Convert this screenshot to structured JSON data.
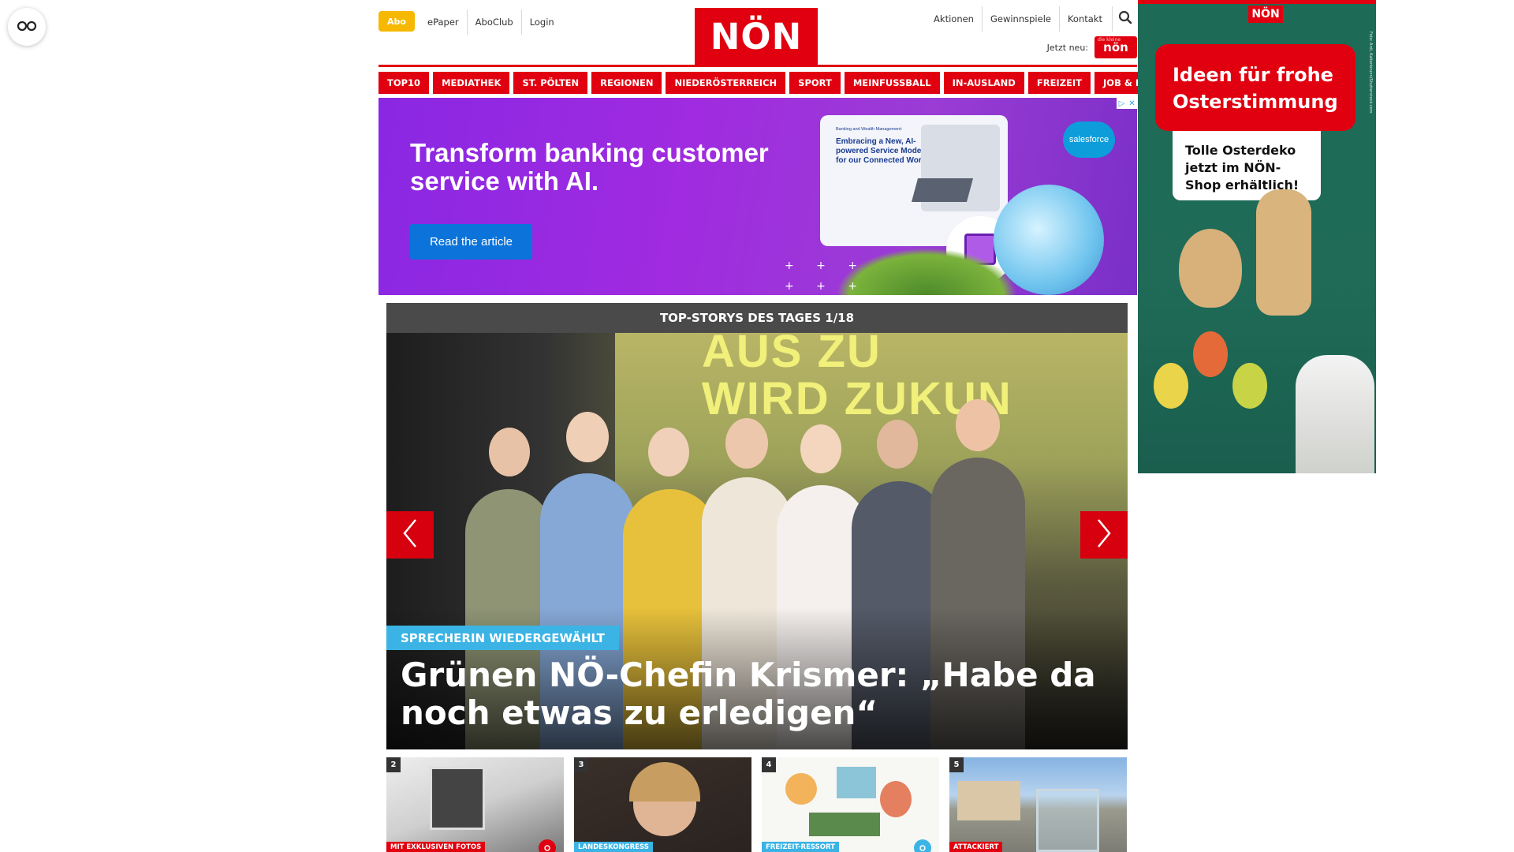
{
  "header": {
    "abo_label": "Abo",
    "left_links": [
      "ePaper",
      "AboClub",
      "Login"
    ],
    "logo_text": "NÖN",
    "right_links": [
      "Aktionen",
      "Gewinnspiele",
      "Kontakt"
    ],
    "jetzt_label": "Jetzt neu:",
    "jetzt_badge": "nön"
  },
  "nav": {
    "items": [
      "TOP10",
      "MEDIATHEK",
      "ST. PÖLTEN",
      "REGIONEN",
      "NIEDERÖSTERREICH",
      "SPORT",
      "MEINFUSSBALL",
      "IN-AUSLAND",
      "FREIZEIT",
      "JOB & KARRIERE"
    ]
  },
  "ad": {
    "headline": "Transform banking customer service with AI.",
    "cta": "Read the article",
    "card_small": "Banking and Wealth Management:",
    "card_text": "Embracing a New, AI-powered Service Model for our Connected World",
    "brand": "salesforce"
  },
  "top_stories": {
    "header": "TOP-STORYS DES TAGES 1/18",
    "screen_text": "AUS ZU\nWIRD ZUKUN",
    "kicker": "SPRECHERIN WIEDERGEWÄHLT",
    "title": "Grünen NÖ-Chefin Krismer: „Habe da noch etwas zu erledigen“"
  },
  "thumbnails": [
    {
      "num": "2",
      "tag": "MIT EXKLUSIVEN FOTOS",
      "tag_color": "#e1000f"
    },
    {
      "num": "3",
      "tag": "LANDESKONGRESS",
      "tag_color": "#3bb4e5"
    },
    {
      "num": "4",
      "tag": "FREIZEIT-RESSORT",
      "tag_color": "#3bb4e5"
    },
    {
      "num": "5",
      "tag": "ATTACKIERT",
      "tag_color": "#e1000f"
    }
  ],
  "side_ad": {
    "logo": "NÖN",
    "headline": "Ideen für frohe Osterstimmung",
    "note": "Tolle Osterdeko jetzt im NÖN-Shop erhältlich!",
    "credit": "Foto: Ardi, Kaltenbrunn/Shutterstock.com"
  },
  "colors": {
    "brand_red": "#e1000f",
    "abo_yellow": "#f6b800",
    "kicker_blue": "#3bb4e5",
    "ad_purple": "#8a27e3",
    "side_green": "#1d6b57"
  }
}
